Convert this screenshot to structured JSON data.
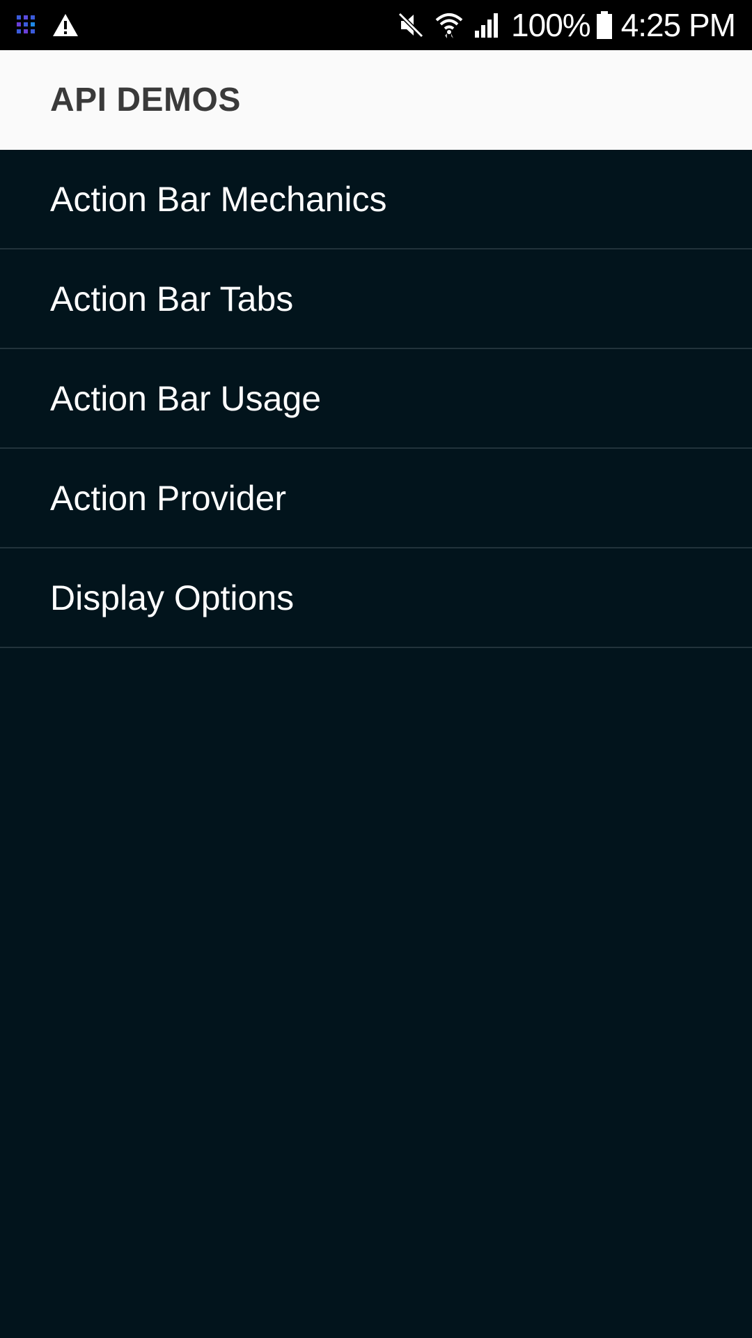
{
  "status_bar": {
    "left_icons": [
      "app-notification-icon",
      "warning-icon"
    ],
    "right_icons": [
      "mute-icon",
      "wifi-icon",
      "signal-icon",
      "battery-icon"
    ],
    "battery_text": "100%",
    "time": "4:25 PM"
  },
  "app_bar": {
    "title": "API DEMOS"
  },
  "list": {
    "items": [
      {
        "label": "Action Bar Mechanics"
      },
      {
        "label": "Action Bar Tabs"
      },
      {
        "label": "Action Bar Usage"
      },
      {
        "label": "Action Provider"
      },
      {
        "label": "Display Options"
      }
    ]
  },
  "colors": {
    "status_bar_bg": "#000000",
    "app_bar_bg": "#fafafa",
    "title_text": "#3a3a3a",
    "list_bg": "#02141c",
    "divider": "#22333b",
    "list_text": "#ffffff"
  }
}
